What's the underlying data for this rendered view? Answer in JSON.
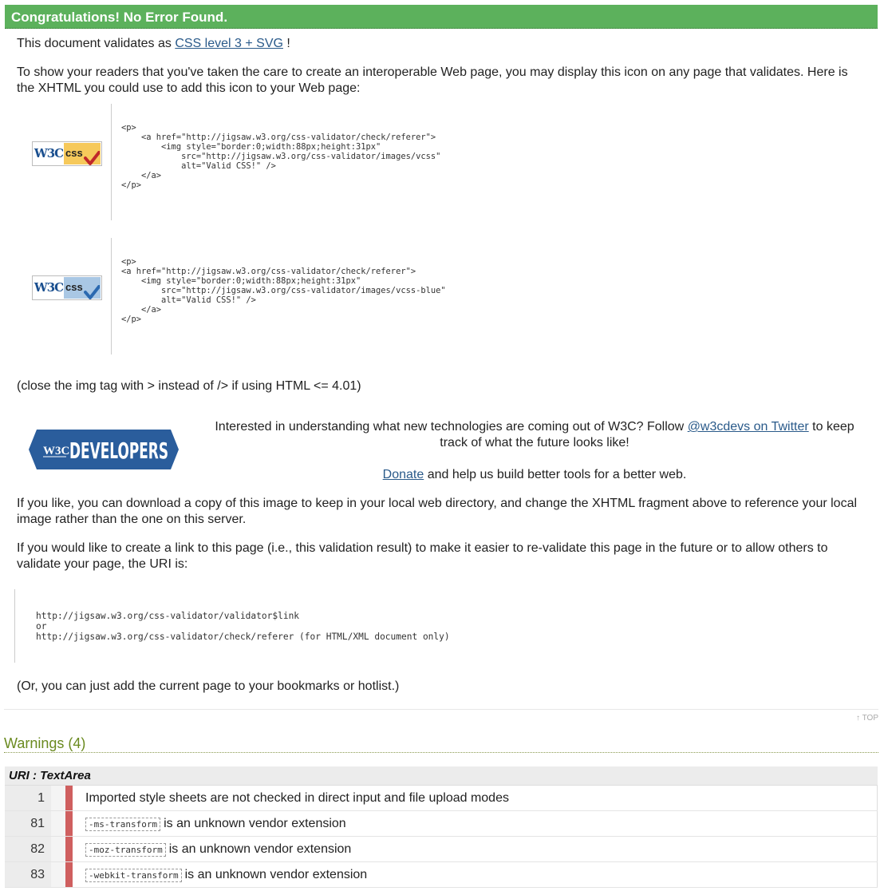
{
  "banner": {
    "title": "Congratulations! No Error Found."
  },
  "validates": {
    "prefix": "This document validates as",
    "link": "CSS level 3 + SVG",
    "suffix": "!"
  },
  "intro": "To show your readers that you've taken the care to create an interoperable Web page, you may display this icon on any page that validates. Here is the XHTML you could use to add this icon to your Web page:",
  "badges": [
    {
      "w3c": "W3C",
      "css": "css",
      "bg": "#f6c95b",
      "tick_color": "#c0282a",
      "code": "<p>\n    <a href=\"http://jigsaw.w3.org/css-validator/check/referer\">\n        <img style=\"border:0;width:88px;height:31px\"\n            src=\"http://jigsaw.w3.org/css-validator/images/vcss\"\n            alt=\"Valid CSS!\" />\n    </a>\n</p>"
    },
    {
      "w3c": "W3C",
      "css": "css",
      "bg": "#a9c7e4",
      "tick_color": "#2b69b0",
      "code": "<p>\n<a href=\"http://jigsaw.w3.org/css-validator/check/referer\">\n    <img style=\"border:0;width:88px;height:31px\"\n        src=\"http://jigsaw.w3.org/css-validator/images/vcss-blue\"\n        alt=\"Valid CSS!\" />\n    </a>\n</p>"
    }
  ],
  "close_note": "(close the img tag with > instead of /> if using HTML <= 4.01)",
  "developers": {
    "logo_w3c": "W3C",
    "logo_text": "DEVELOPERS",
    "logo_color": "#2a5d9c",
    "text_before": "Interested in understanding what new technologies are coming out of W3C? Follow",
    "twitter_link": "@w3cdevs on Twitter",
    "text_after": "to keep track of what the future looks like!",
    "donate_link": "Donate",
    "donate_after": "and help us build better tools for a better web."
  },
  "download_note": "If you like, you can download a copy of this image to keep in your local web directory, and change the XHTML fragment above to reference your local image rather than the one on this server.",
  "link_note": "If you would like to create a link to this page (i.e., this validation result) to make it easier to re-validate this page in the future or to allow others to validate your page, the URI is:",
  "uri_block": "http://jigsaw.w3.org/css-validator/validator$link\nor\nhttp://jigsaw.w3.org/css-validator/check/referer (for HTML/XML document only)",
  "bookmark_note": "(Or, you can just add the current page to your bookmarks or hotlist.)",
  "top_link": "↑ TOP",
  "warnings": {
    "title": "Warnings (4)",
    "uri_label": "URI : TextArea",
    "accent_color": "#cf5f5f",
    "rows": [
      {
        "line": "1",
        "token": "",
        "message": "Imported style sheets are not checked in direct input and file upload modes"
      },
      {
        "line": "81",
        "token": "-ms-transform",
        "message": "is an unknown vendor extension"
      },
      {
        "line": "82",
        "token": "-moz-transform",
        "message": "is an unknown vendor extension"
      },
      {
        "line": "83",
        "token": "-webkit-transform",
        "message": "is an unknown vendor extension"
      }
    ]
  }
}
